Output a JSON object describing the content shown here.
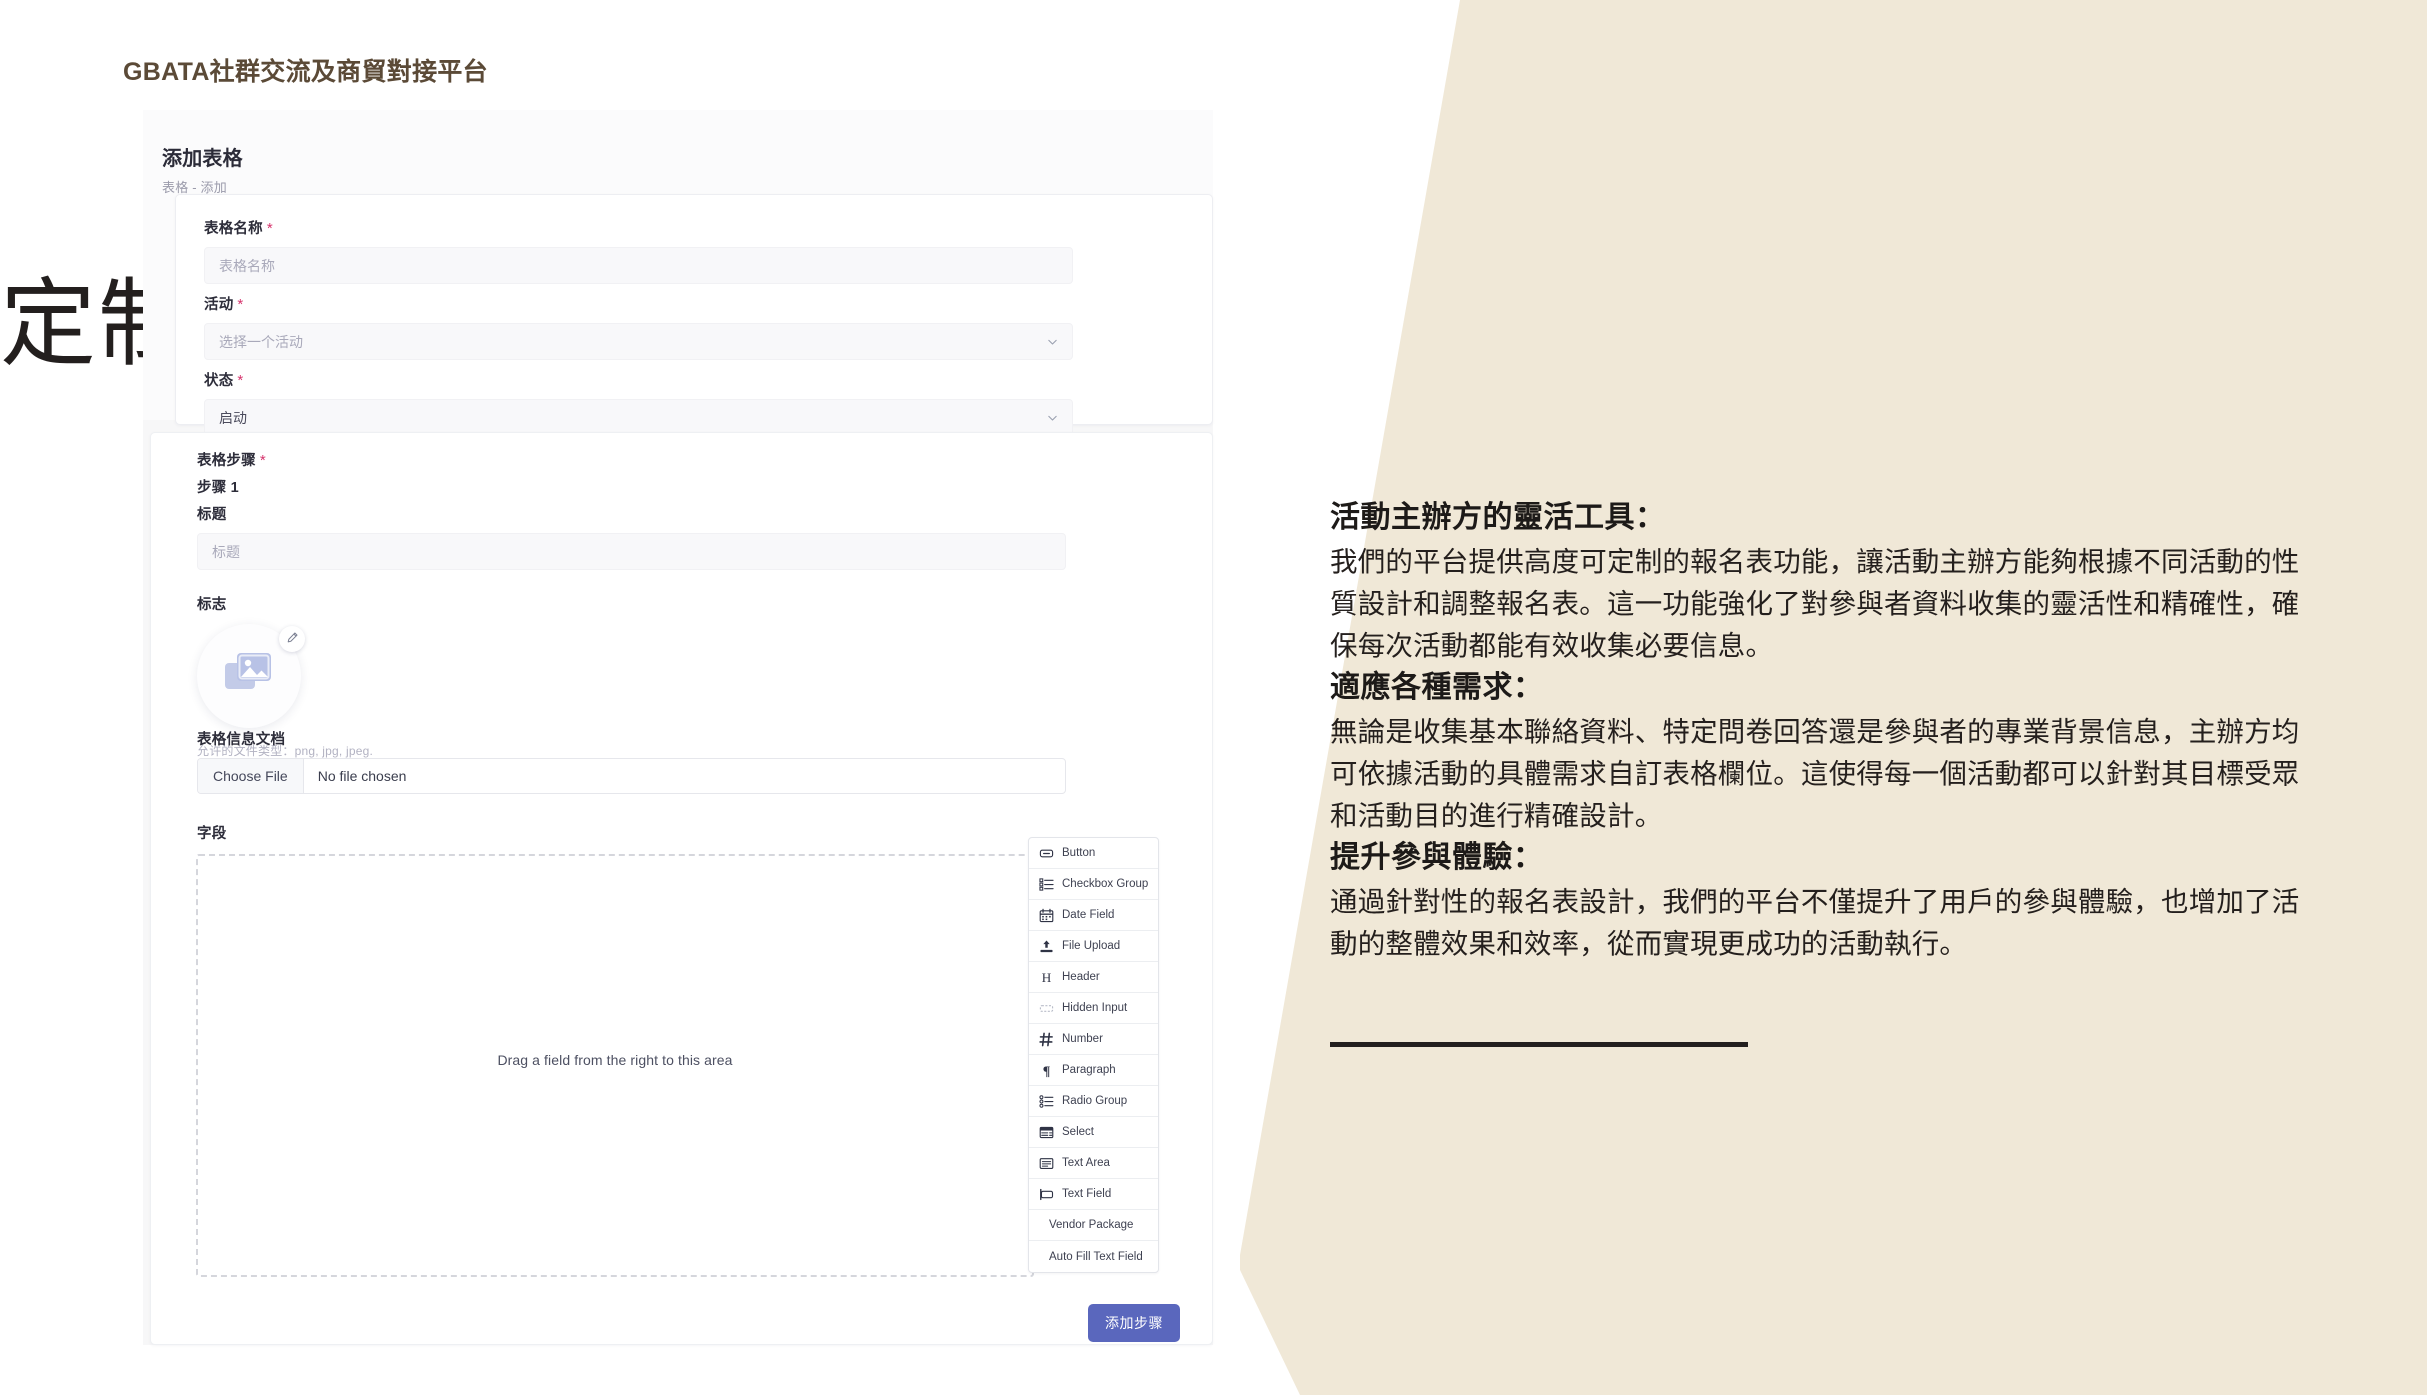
{
  "app": {
    "title": "GBATA社群交流及商貿對接平台"
  },
  "page": {
    "title": "添加表格",
    "breadcrumb": "表格 - 添加"
  },
  "form": {
    "name_label": "表格名称",
    "name_placeholder": "表格名称",
    "activity_label": "活动",
    "activity_placeholder": "选择一个活动",
    "status_label": "状态",
    "status_value": "启动",
    "required_mark": "*",
    "steps_label": "表格步骤",
    "step_number": "步骤 1",
    "step_title_label": "标题",
    "step_title_placeholder": "标题",
    "logo_label": "标志",
    "logo_hint": "允许的文件类型：png, jpg, jpeg.",
    "doc_label": "表格信息文档",
    "file_button": "Choose File",
    "file_status": "No file chosen",
    "fields_label": "字段",
    "dropzone_text": "Drag a field from the right to this area",
    "add_step_button": "添加步骤"
  },
  "palette": {
    "items": [
      {
        "label": "Button",
        "icon": "button-icon"
      },
      {
        "label": "Checkbox Group",
        "icon": "checkbox-group-icon"
      },
      {
        "label": "Date Field",
        "icon": "calendar-icon"
      },
      {
        "label": "File Upload",
        "icon": "upload-icon"
      },
      {
        "label": "Header",
        "icon": "header-h-icon"
      },
      {
        "label": "Hidden Input",
        "icon": "hidden-input-icon"
      },
      {
        "label": "Number",
        "icon": "hash-icon"
      },
      {
        "label": "Paragraph",
        "icon": "pilcrow-icon"
      },
      {
        "label": "Radio Group",
        "icon": "radio-group-icon"
      },
      {
        "label": "Select",
        "icon": "select-icon"
      },
      {
        "label": "Text Area",
        "icon": "text-area-icon"
      },
      {
        "label": "Text Field",
        "icon": "text-field-icon"
      },
      {
        "label": "Vendor Package",
        "icon": ""
      },
      {
        "label": "Auto Fill Text Field",
        "icon": ""
      }
    ]
  },
  "promo": {
    "heading": "定制化活動報名表",
    "sections": [
      {
        "title": "活動主辦方的靈活工具：",
        "body": "我們的平台提供高度可定制的報名表功能，讓活動主辦方能夠根據不同活動的性質設計和調整報名表。這一功能強化了對參與者資料收集的靈活性和精確性，確保每次活動都能有效收集必要信息。"
      },
      {
        "title": "適應各種需求：",
        "body": "無論是收集基本聯絡資料、特定問卷回答還是參與者的專業背景信息，主辦方均可依據活動的具體需求自訂表格欄位。這使得每一個活動都可以針對其目標受眾和活動目的進行精確設計。"
      },
      {
        "title": "提升參與體驗：",
        "body": "通過針對性的報名表設計，我們的平台不僅提升了用戶的參與體驗，也增加了活動的整體效果和效率，從而實現更成功的活動執行。"
      }
    ]
  },
  "colors": {
    "beige": "#F0E8D7",
    "accent": "#5a67bd",
    "title_brown": "#5b4a37",
    "required": "#d6336c"
  }
}
